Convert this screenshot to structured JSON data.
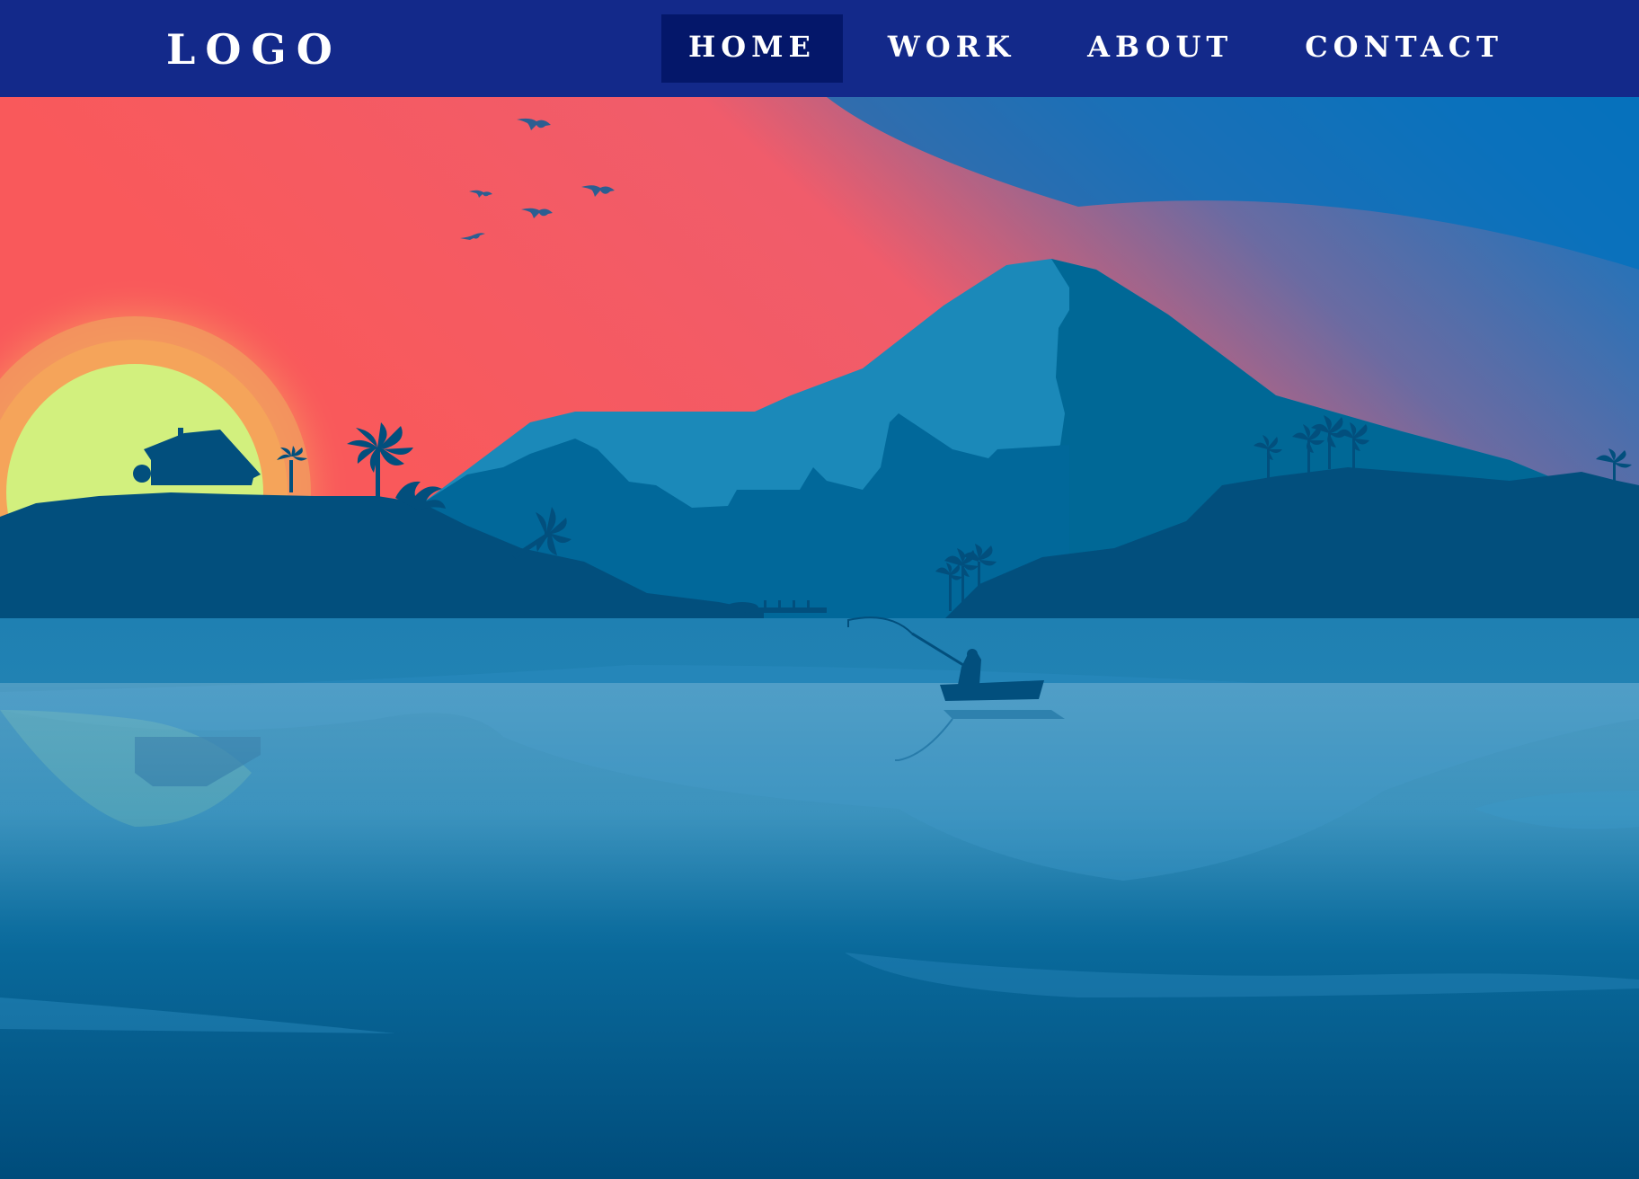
{
  "header": {
    "logo": "LOGO",
    "nav": [
      {
        "label": "HOME",
        "active": true
      },
      {
        "label": "WORK",
        "active": false
      },
      {
        "label": "ABOUT",
        "active": false
      },
      {
        "label": "CONTACT",
        "active": false
      }
    ]
  },
  "colors": {
    "nav_background": "#13298a",
    "nav_active_background": "#04176a",
    "nav_text": "#ffffff",
    "sky_sunset": "#f9595b",
    "sky_blue": "#0071bd",
    "sun": "#d2f07e",
    "mountain_light": "#1b89b9",
    "mountain_dark": "#006896",
    "foreground_land": "#024f7d",
    "water": "#1f7fb1"
  },
  "hero": {
    "scene": "sunset-lake-landscape-illustration"
  }
}
